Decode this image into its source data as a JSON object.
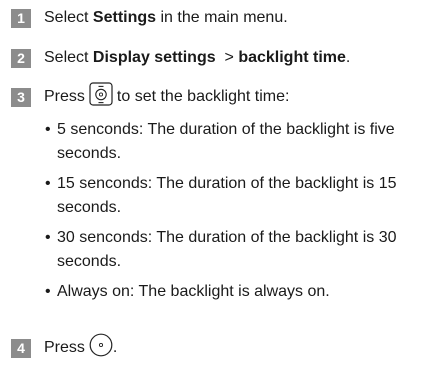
{
  "steps": [
    {
      "number": "1",
      "pre": "Select ",
      "bold": "Settings",
      "post": " in the main menu."
    },
    {
      "number": "2",
      "pre": "Select ",
      "bold": "Display settings",
      "mid": "  > ",
      "bold2": "backlight time",
      "post": "."
    },
    {
      "number": "3",
      "pre": "Press ",
      "icon": "nav-key-icon",
      "post": " to set the backlight time:"
    },
    {
      "number": "4",
      "pre": "Press ",
      "icon": "ok-key-icon",
      "post": "."
    }
  ],
  "options": [
    "5 senconds: The duration of the backlight is five seconds.",
    "15 senconds: The duration of the backlight is 15 seconds.",
    "30 senconds: The duration of the backlight is 30 seconds.",
    "Always on: The backlight is always on."
  ],
  "bullet_glyph": "•",
  "colors": {
    "number_badge": "#8c8c8c",
    "text": "#1a1a1a"
  }
}
